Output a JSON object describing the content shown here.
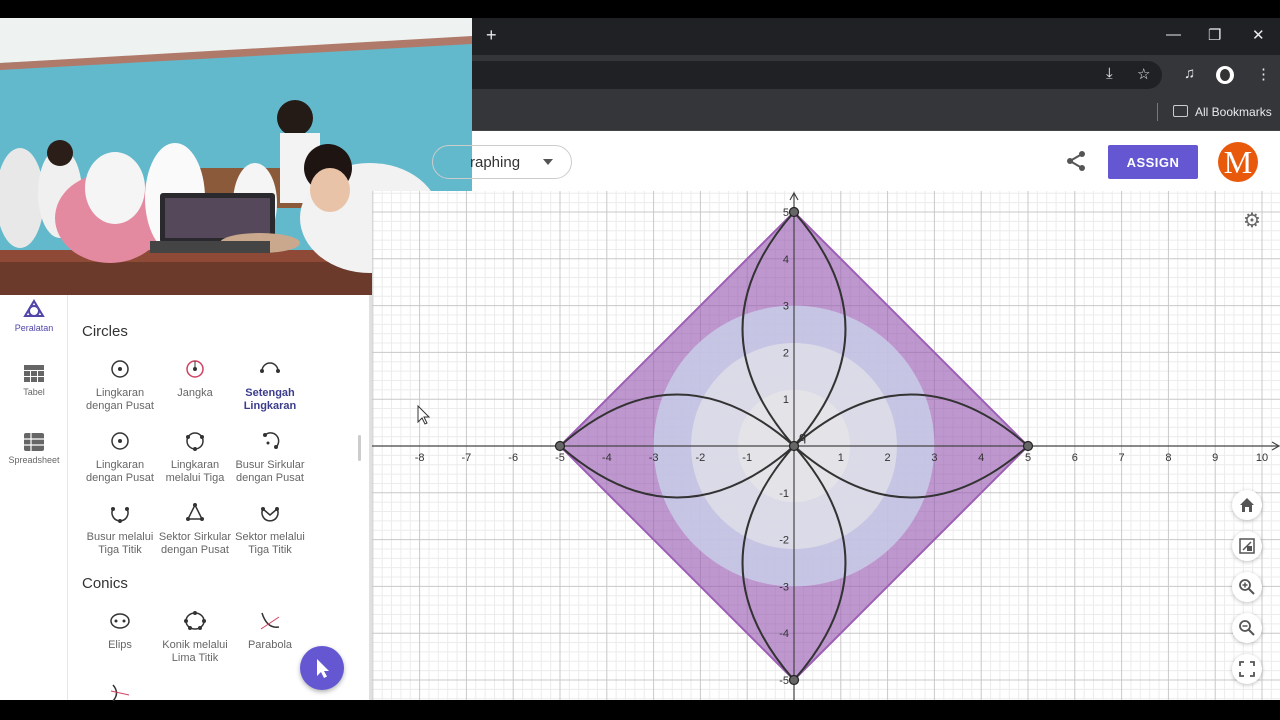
{
  "browser": {
    "new_tab_glyph": "+",
    "bookmarks_label": "All Bookmarks",
    "window_controls": {
      "minimize": "—",
      "restore": "❐",
      "close": "✕"
    }
  },
  "header": {
    "app_label": "raphing",
    "assign_label": "ASSIGN",
    "logo_letter": "M",
    "accent_color": "#6557d2",
    "logo_color": "#e8590c"
  },
  "rail": {
    "items": [
      {
        "label": "Peralatan",
        "icon": "tools-icon",
        "active": true
      },
      {
        "label": "Tabel",
        "icon": "table-icon",
        "active": false
      },
      {
        "label": "Spreadsheet",
        "icon": "spreadsheet-icon",
        "active": false
      }
    ]
  },
  "tools": {
    "circles_title": "Circles",
    "conics_title": "Conics",
    "circles": [
      {
        "line1": "Lingkaran",
        "line2": "dengan Pusat",
        "icon": "circle-center-icon"
      },
      {
        "line1": "Jangka",
        "line2": "",
        "icon": "compass-icon"
      },
      {
        "line1": "Setengah",
        "line2": "Lingkaran",
        "icon": "semicircle-icon",
        "selected": true
      },
      {
        "line1": "Lingkaran",
        "line2": "dengan Pusat",
        "icon": "circle-center-icon"
      },
      {
        "line1": "Lingkaran",
        "line2": "melalui Tiga",
        "icon": "circle-three-points-icon"
      },
      {
        "line1": "Busur Sirkular",
        "line2": "dengan Pusat",
        "icon": "arc-center-icon"
      },
      {
        "line1": "Busur melalui",
        "line2": "Tiga Titik",
        "icon": "arc-three-points-icon"
      },
      {
        "line1": "Sektor Sirkular",
        "line2": "dengan Pusat",
        "icon": "sector-center-icon"
      },
      {
        "line1": "Sektor melalui",
        "line2": "Tiga Titik",
        "icon": "sector-three-points-icon"
      }
    ],
    "conics": [
      {
        "line1": "Elips",
        "line2": "",
        "icon": "ellipse-icon"
      },
      {
        "line1": "Konik melalui",
        "line2": "Lima Titik",
        "icon": "conic-five-points-icon"
      },
      {
        "line1": "Parabola",
        "line2": "",
        "icon": "parabola-icon"
      }
    ]
  },
  "graph": {
    "point_label": "q",
    "x_ticks": [
      -8,
      -7,
      -6,
      -5,
      -4,
      -3,
      -2,
      -1,
      1,
      2,
      3,
      4,
      5,
      6,
      7,
      8,
      9,
      10
    ],
    "y_ticks": [
      5,
      4,
      3,
      2,
      1,
      -1,
      -2,
      -3,
      -4,
      -5
    ],
    "diamond_color": "#9c5fb5",
    "curve_color": "#333333",
    "disk_color": "#c8cce8"
  }
}
